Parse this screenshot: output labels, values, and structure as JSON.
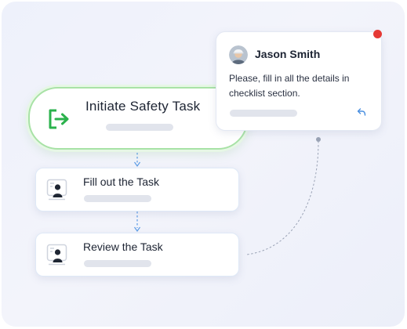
{
  "flow": {
    "start": {
      "title": "Initiate Safety Task",
      "icon": "exit-arrow-icon",
      "accent_color": "#2bb24c"
    },
    "steps": [
      {
        "title": "Fill out the Task",
        "icon": "user-badge-icon"
      },
      {
        "title": "Review the Task",
        "icon": "user-badge-icon"
      }
    ],
    "connector_color": "#5b9be6"
  },
  "comment": {
    "author": "Jason Smith",
    "message": "Please, fill in all the details in checklist section.",
    "reply_icon": "reply-icon",
    "notification_color": "#e53935"
  }
}
